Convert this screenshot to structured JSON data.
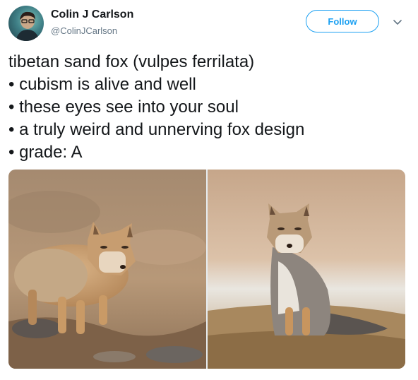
{
  "author": {
    "name": "Colin J Carlson",
    "handle": "@ColinJCarlson"
  },
  "actions": {
    "follow_label": "Follow",
    "menu_icon": "chevron-down-icon"
  },
  "tweet": {
    "lines": [
      "tibetan sand fox (vulpes ferrilata)",
      "• cubism is alive and well",
      "• these eyes see into your soul",
      "• a truly weird and unnerving fox design",
      "• grade: A"
    ]
  },
  "media": {
    "photo_count": 2
  },
  "colors": {
    "accent": "#1da1f2",
    "text": "#14171a",
    "secondary": "#657786"
  }
}
